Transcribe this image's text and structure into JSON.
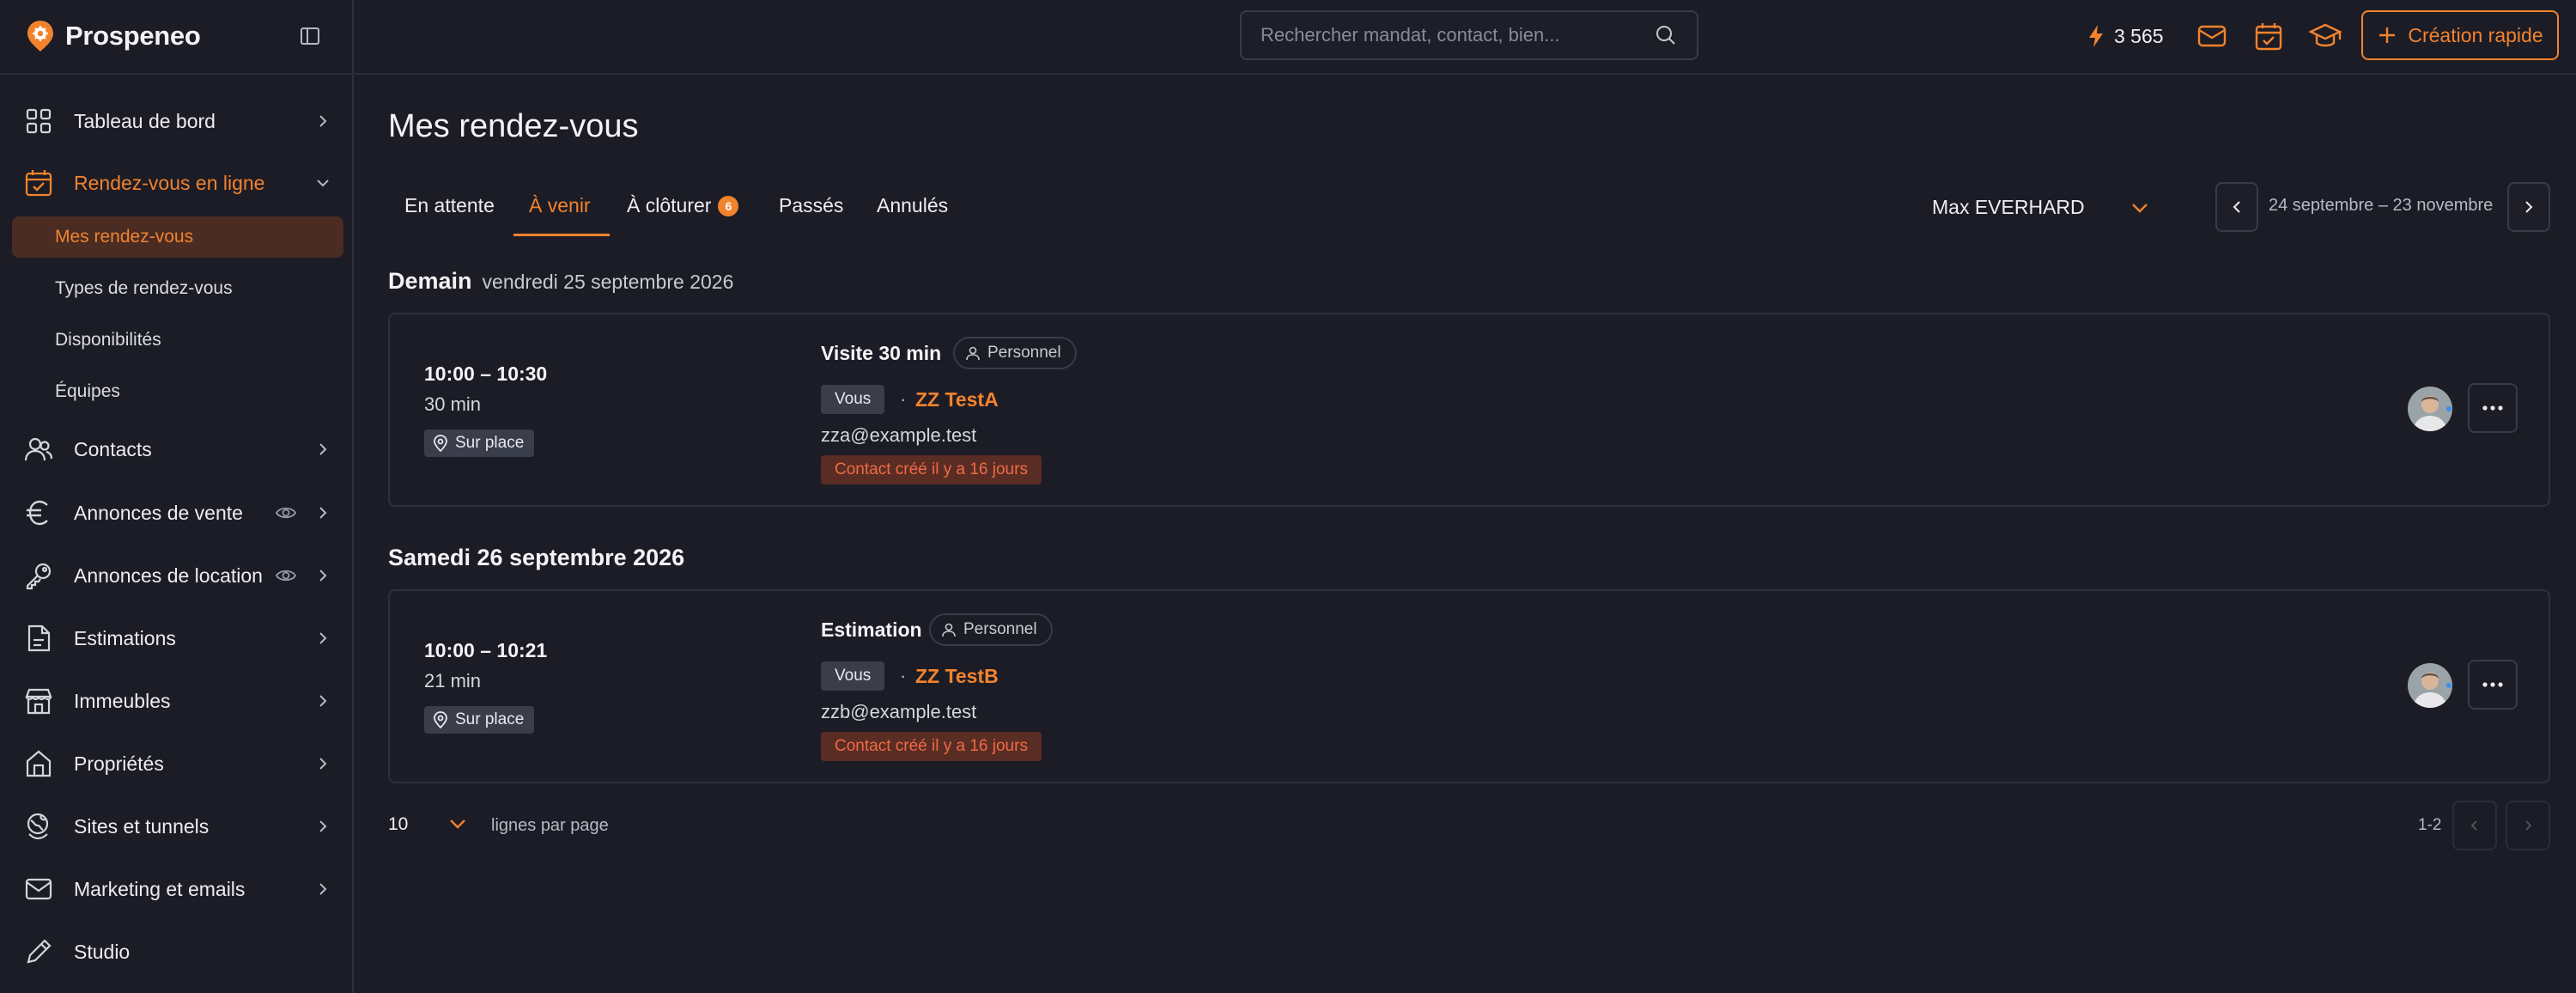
{
  "app": {
    "name": "Prospeneo"
  },
  "sidebar": {
    "items": [
      {
        "label": "Tableau de bord",
        "icon": "dashboard-grid-icon"
      },
      {
        "label": "Rendez-vous en ligne",
        "icon": "calendar-check-icon"
      },
      {
        "label": "Contacts",
        "icon": "users-icon"
      },
      {
        "label": "Annonces de vente",
        "icon": "euro-icon"
      },
      {
        "label": "Annonces de location",
        "icon": "key-icon"
      },
      {
        "label": "Estimations",
        "icon": "document-icon"
      },
      {
        "label": "Immeubles",
        "icon": "storefront-icon"
      },
      {
        "label": "Propriétés",
        "icon": "house-icon"
      },
      {
        "label": "Sites et tunnels",
        "icon": "globe-pin-icon"
      },
      {
        "label": "Marketing et emails",
        "icon": "mail-icon"
      },
      {
        "label": "Studio",
        "icon": "pencil-icon"
      }
    ],
    "subitems": [
      {
        "label": "Mes rendez-vous"
      },
      {
        "label": "Types de rendez-vous"
      },
      {
        "label": "Disponibilités"
      },
      {
        "label": "Équipes"
      }
    ]
  },
  "header": {
    "search_placeholder": "Rechercher mandat, contact, bien...",
    "credits": "3 565",
    "quick_create_label": "Création rapide"
  },
  "main": {
    "title": "Mes rendez-vous",
    "tabs": [
      {
        "label": "En attente"
      },
      {
        "label": "À venir"
      },
      {
        "label": "À clôturer",
        "badge": "6"
      },
      {
        "label": "Passés"
      },
      {
        "label": "Annulés"
      }
    ],
    "user_filter": "Max EVERHARD",
    "date_range": "24 septembre – 23 novembre"
  },
  "groups": [
    {
      "heading": "Demain",
      "subheading": "vendredi 25 septembre 2026",
      "appointment": {
        "time": "10:00 – 10:30",
        "duration": "30 min",
        "location": "Sur place",
        "type": "Visite 30 min",
        "type_tag": "Personnel",
        "host": "Vous",
        "separator": "·",
        "contact": "ZZ TestA",
        "email": "zza@example.test",
        "created_note": "Contact créé il y a 16 jours"
      }
    },
    {
      "heading": "Samedi 26 septembre 2026",
      "subheading": "",
      "appointment": {
        "time": "10:00 – 10:21",
        "duration": "21 min",
        "location": "Sur place",
        "type": "Estimation",
        "type_tag": "Personnel",
        "host": "Vous",
        "separator": "·",
        "contact": "ZZ TestB",
        "email": "zzb@example.test",
        "created_note": "Contact créé il y a 16 jours"
      }
    }
  ],
  "pagination": {
    "rows_per_page": "10",
    "rows_label": "lignes par page",
    "range": "1-2"
  },
  "colors": {
    "accent": "#f2832d",
    "background": "#1c1c26",
    "border": "#30303d",
    "danger_bg": "#5a2d24"
  }
}
